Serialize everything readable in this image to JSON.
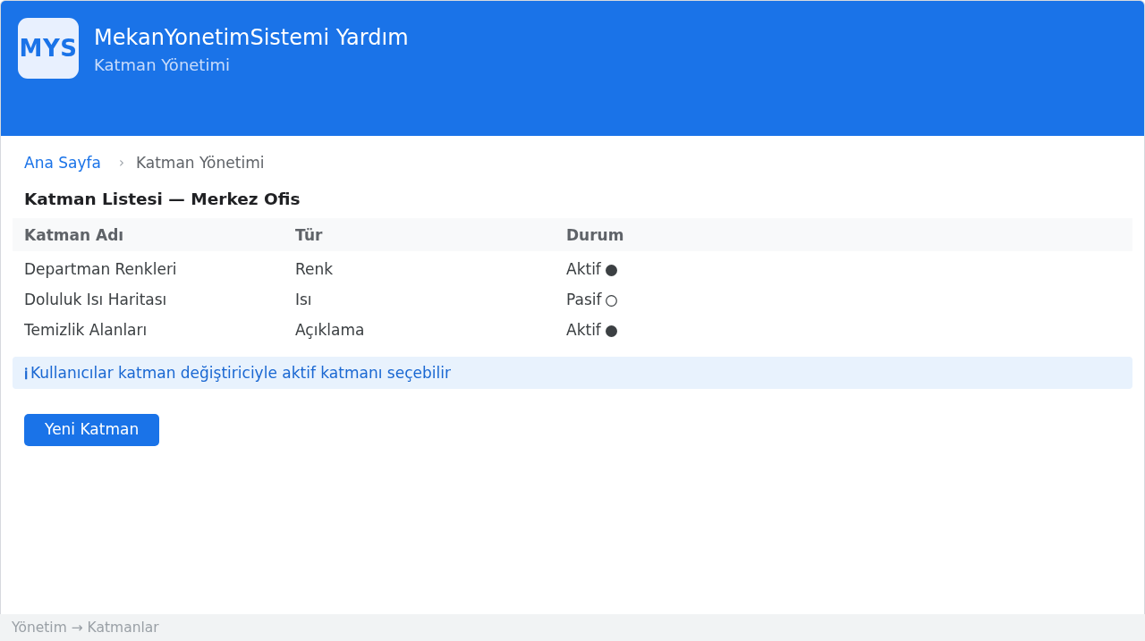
{
  "header": {
    "logo": "MYS",
    "title": "MekanYonetimSistemi Yardım",
    "subtitle": "Katman Yönetimi"
  },
  "breadcrumb": {
    "separator": "›",
    "items": [
      {
        "label": "Ana Sayfa",
        "kind": "link"
      },
      {
        "label": "Katman Yönetimi",
        "kind": "current"
      }
    ]
  },
  "section_title": "Katman Listesi — Merkez Ofis",
  "table": {
    "columns": [
      "Katman Adı",
      "Tür",
      "Durum"
    ],
    "rows": [
      {
        "name": "Departman Renkleri",
        "type": "Renk",
        "status": "Aktif",
        "active": true
      },
      {
        "name": "Doluluk Isı Haritası",
        "type": "Isı",
        "status": "Pasif",
        "active": false
      },
      {
        "name": "Temizlik Alanları",
        "type": "Açıklama",
        "status": "Aktif",
        "active": true
      }
    ]
  },
  "notice": {
    "icon": "ℹ",
    "text": "Kullanıcılar katman değiştiriciyle aktif katmanı seçebilir"
  },
  "buttons": [
    {
      "label": "Yeni Katman"
    }
  ],
  "status_bar": {
    "path": "Yönetim → Katmanlar"
  }
}
